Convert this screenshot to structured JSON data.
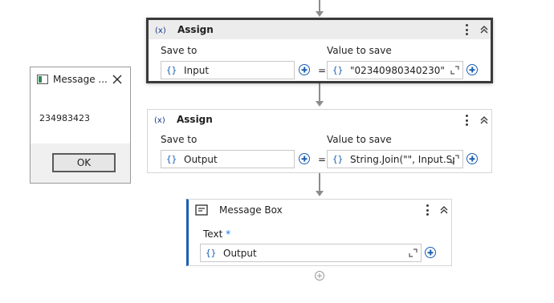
{
  "message_dialog": {
    "title": "Message ...",
    "text": "234983423",
    "ok_label": "OK"
  },
  "assign_1": {
    "title": "Assign",
    "save_to_label": "Save to",
    "value_label": "Value to save",
    "save_to_value": "Input",
    "value_expression": "\"02340980340230\"",
    "equals": "=",
    "brace": "{}"
  },
  "assign_2": {
    "title": "Assign",
    "save_to_label": "Save to",
    "value_label": "Value to save",
    "save_to_value": "Output",
    "value_expression": "String.Join(\"\", Input.Sp",
    "equals": "=",
    "brace": "{}"
  },
  "message_box": {
    "title": "Message Box",
    "text_label": "Text",
    "required_marker": "*",
    "text_value": "Output",
    "brace": "{}"
  },
  "colors": {
    "accent": "#1a5fb4",
    "connector": "#8c8c8c",
    "selected_border": "#3a3a3a"
  }
}
